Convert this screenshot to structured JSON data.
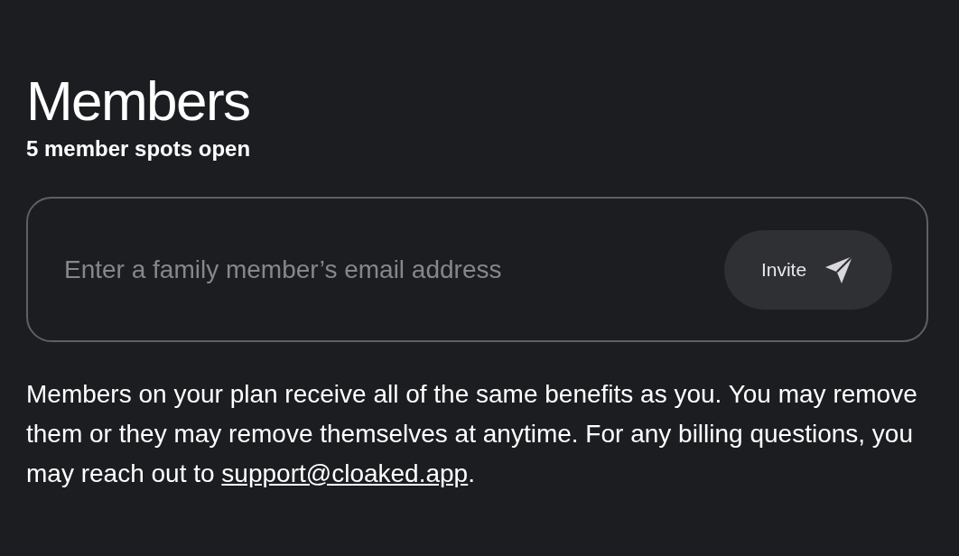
{
  "title": "Members",
  "subtitle": "5 member spots open",
  "invite": {
    "placeholder": "Enter a family member’s email address",
    "button": "Invite"
  },
  "description": {
    "text": "Members on your plan receive all of the same benefits as you. You may remove them or they may remove themselves at anytime. For any billing questions, you may reach out to ",
    "link": "support@cloaked.app",
    "after": "."
  }
}
